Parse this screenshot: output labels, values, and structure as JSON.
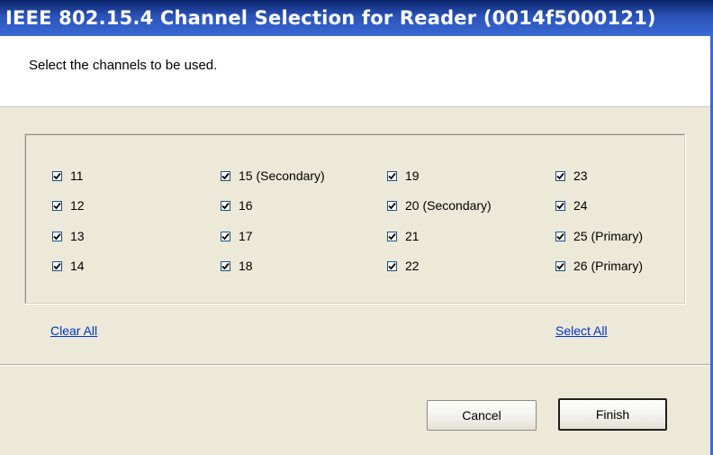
{
  "window": {
    "title": "IEEE 802.15.4 Channel Selection for Reader (0014f5000121)"
  },
  "header": {
    "instruction": "Select the channels to be used."
  },
  "channels": [
    {
      "label": "11",
      "checked": true
    },
    {
      "label": "12",
      "checked": true
    },
    {
      "label": "13",
      "checked": true
    },
    {
      "label": "14",
      "checked": true
    },
    {
      "label": "15 (Secondary)",
      "checked": true
    },
    {
      "label": "16",
      "checked": true
    },
    {
      "label": "17",
      "checked": true
    },
    {
      "label": "18",
      "checked": true
    },
    {
      "label": "19",
      "checked": true
    },
    {
      "label": "20 (Secondary)",
      "checked": true
    },
    {
      "label": "21",
      "checked": true
    },
    {
      "label": "22",
      "checked": true
    },
    {
      "label": "23",
      "checked": true
    },
    {
      "label": "24",
      "checked": true
    },
    {
      "label": "25 (Primary)",
      "checked": true
    },
    {
      "label": "26 (Primary)",
      "checked": true
    }
  ],
  "actions": {
    "clear_all": "Clear All",
    "select_all": "Select All"
  },
  "buttons": {
    "cancel": "Cancel",
    "finish": "Finish"
  },
  "colors": {
    "titlebar": "#0a246a",
    "link": "#0033cc",
    "dialog_background": "#ece9d8"
  }
}
